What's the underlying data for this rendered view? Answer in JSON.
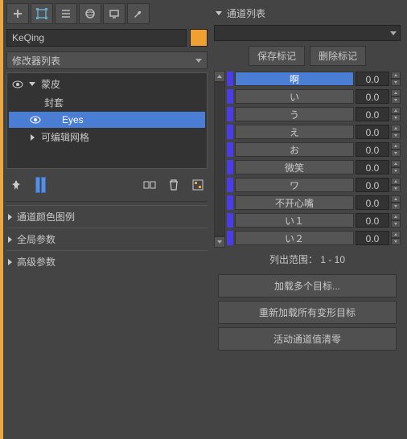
{
  "toolbar_icons": [
    "plus",
    "transform",
    "list",
    "circle",
    "monitor",
    "wrench"
  ],
  "object_name": "KeQing",
  "swatch_color": "#f0a030",
  "modifier_list_label": "修改器列表",
  "stack": [
    {
      "label": "蒙皮",
      "expanded": true,
      "eye": true
    },
    {
      "label": "封套",
      "indent": 2,
      "eye": false
    },
    {
      "label": "Eyes",
      "indent": 2,
      "eye": true,
      "selected": true
    },
    {
      "label": "可编辑网格",
      "expanded": false,
      "eye": false
    }
  ],
  "rollouts": [
    "通道颜色图例",
    "全局参数",
    "高级参数"
  ],
  "right_header": "通道列表",
  "save_marker": "保存标记",
  "delete_marker": "删除标记",
  "channels": [
    {
      "name": "啊",
      "val": "0.0",
      "selected": true
    },
    {
      "name": "い",
      "val": "0.0"
    },
    {
      "name": "う",
      "val": "0.0"
    },
    {
      "name": "え",
      "val": "0.0"
    },
    {
      "name": "お",
      "val": "0.0"
    },
    {
      "name": "微笑",
      "val": "0.0"
    },
    {
      "name": "ワ",
      "val": "0.0"
    },
    {
      "name": "不开心嘴",
      "val": "0.0"
    },
    {
      "name": "い１",
      "val": "0.0"
    },
    {
      "name": "い２",
      "val": "0.0"
    }
  ],
  "range_text": "列出范围： 1 - 10",
  "btn_load_multi": "加载多个目标...",
  "btn_reload_all": "重新加载所有变形目标",
  "btn_zero_active": "活动通道值清零"
}
